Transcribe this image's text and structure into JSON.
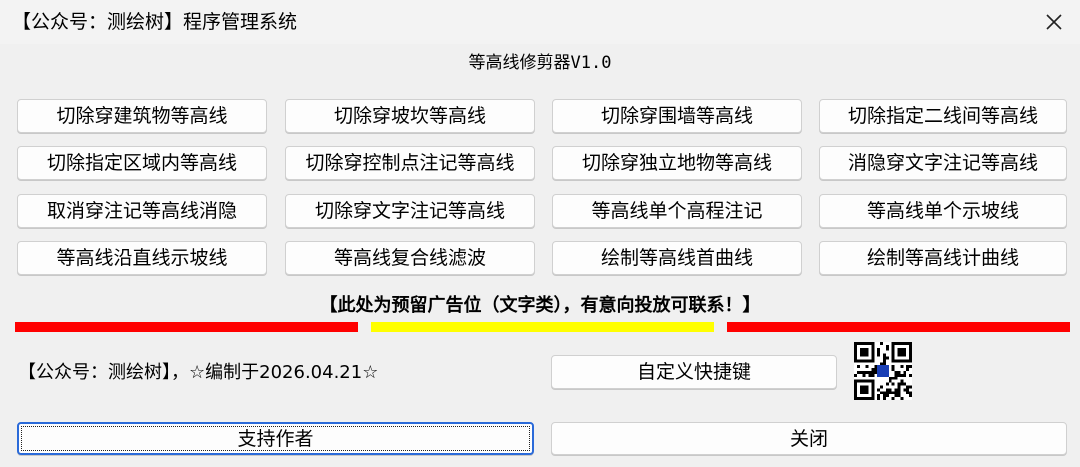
{
  "window": {
    "title": "【公众号：测绘树】程序管理系统"
  },
  "app": {
    "subtitle": "等高线修剪器V1.0"
  },
  "function_buttons": [
    {
      "label": "切除穿建筑物等高线"
    },
    {
      "label": "切除穿坡坎等高线"
    },
    {
      "label": "切除穿围墙等高线"
    },
    {
      "label": "切除指定二线间等高线"
    },
    {
      "label": "切除指定区域内等高线"
    },
    {
      "label": "切除穿控制点注记等高线"
    },
    {
      "label": "切除穿独立地物等高线"
    },
    {
      "label": "消隐穿文字注记等高线"
    },
    {
      "label": "取消穿注记等高线消隐"
    },
    {
      "label": "切除穿文字注记等高线"
    },
    {
      "label": "等高线单个高程注记"
    },
    {
      "label": "等高线单个示坡线"
    },
    {
      "label": "等高线沿直线示坡线"
    },
    {
      "label": "等高线复合线滤波"
    },
    {
      "label": "绘制等高线首曲线"
    },
    {
      "label": "绘制等高线计曲线"
    }
  ],
  "ad": {
    "text": "【此处为预留广告位（文字类），有意向投放可联系！】",
    "colors": [
      "#ff0000",
      "#ffff00",
      "#ff0000"
    ]
  },
  "footer": {
    "info": "【公众号：测绘树】，☆编制于2026.04.21☆",
    "shortcut_label": "自定义快捷键",
    "qr_icon": "qr-code-icon"
  },
  "bottom_buttons": {
    "support_label": "支持作者",
    "close_label": "关闭"
  }
}
